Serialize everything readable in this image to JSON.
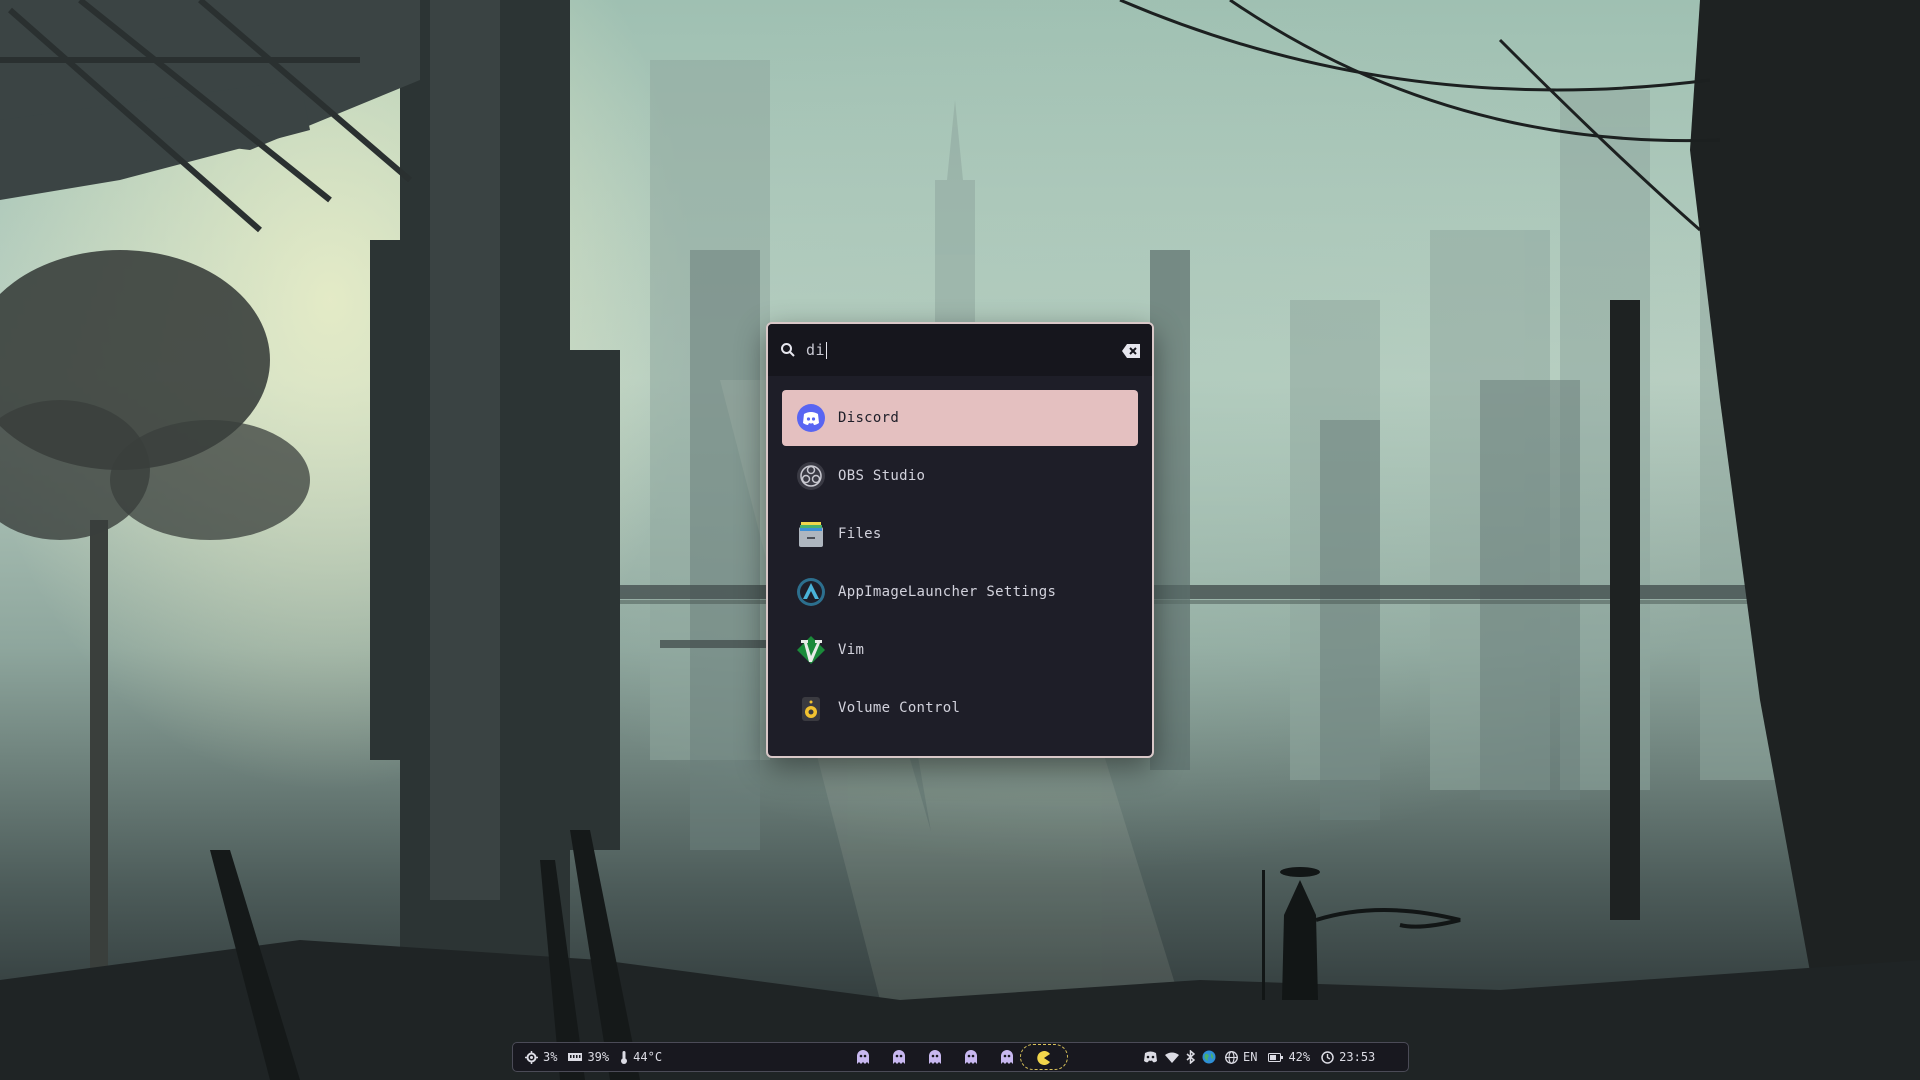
{
  "launcher": {
    "query": "di",
    "results": [
      {
        "label": "Discord",
        "icon": "discord-icon",
        "selected": true
      },
      {
        "label": "OBS Studio",
        "icon": "obs-icon",
        "selected": false
      },
      {
        "label": "Files",
        "icon": "files-icon",
        "selected": false
      },
      {
        "label": "AppImageLauncher Settings",
        "icon": "appimagelauncher-icon",
        "selected": false
      },
      {
        "label": "Vim",
        "icon": "vim-icon",
        "selected": false
      },
      {
        "label": "Volume Control",
        "icon": "volume-control-icon",
        "selected": false
      }
    ]
  },
  "bar": {
    "cpu": "3%",
    "memory": "39%",
    "temperature": "44°C",
    "workspaces": [
      "ghost-icon",
      "ghost-icon",
      "ghost-icon",
      "ghost-icon",
      "ghost-icon"
    ],
    "active_workspace_icon": "pacman-icon",
    "tray_icons": [
      "discord-icon",
      "wifi-icon",
      "bluetooth-icon",
      "globe-icon"
    ],
    "language": "EN",
    "battery": "42%",
    "time": "23:53"
  },
  "colors": {
    "launcher_bg": "#1e1e28",
    "selection": "#e4c0c0",
    "bar_bg": "#18181f",
    "accent_yellow": "#f2d64b"
  }
}
